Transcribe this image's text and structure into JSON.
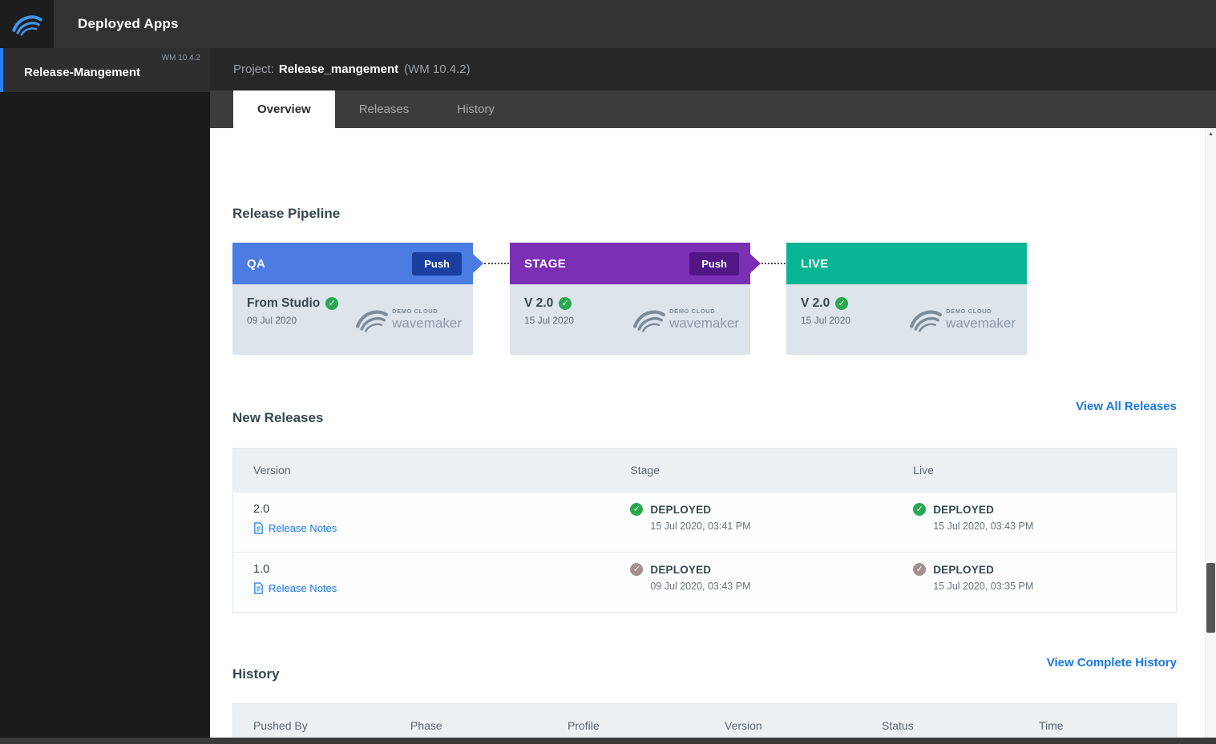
{
  "topbar": {
    "title": "Deployed Apps"
  },
  "sidebar": {
    "selected": {
      "name": "Release-Mangement",
      "version": "WM 10.4.2"
    }
  },
  "project_header": {
    "label": "Project:",
    "name": "Release_mangement",
    "version": "(WM 10.4.2)"
  },
  "tabs": [
    {
      "label": "Overview",
      "active": true
    },
    {
      "label": "Releases",
      "active": false
    },
    {
      "label": "History",
      "active": false
    }
  ],
  "pipeline": {
    "heading": "Release Pipeline",
    "stages": [
      {
        "name": "QA",
        "push_label": "Push",
        "version": "From Studio",
        "date": "09 Jul 2020",
        "header_color": "#4a7ce2",
        "push_color": "#1b3f9f"
      },
      {
        "name": "STAGE",
        "push_label": "Push",
        "version": "V 2.0",
        "date": "15 Jul 2020",
        "header_color": "#7b2fb4",
        "push_color": "#521786"
      },
      {
        "name": "LIVE",
        "version": "V 2.0",
        "date": "15 Jul 2020",
        "header_color": "#07b493"
      }
    ],
    "logo": {
      "line1": "DEMO CLOUD",
      "line2": "wavemaker"
    }
  },
  "new_releases": {
    "heading": "New Releases",
    "view_all_label": "View All Releases",
    "columns": [
      "Version",
      "Stage",
      "Live"
    ],
    "rows": [
      {
        "version": "2.0",
        "notes_label": "Release Notes",
        "stage": {
          "status": "DEPLOYED",
          "time": "15 Jul 2020, 03:41 PM",
          "check_color": "green"
        },
        "live": {
          "status": "DEPLOYED",
          "time": "15 Jul 2020, 03:43 PM",
          "check_color": "green"
        }
      },
      {
        "version": "1.0",
        "notes_label": "Release Notes",
        "stage": {
          "status": "DEPLOYED",
          "time": "09 Jul 2020, 03:43 PM",
          "check_color": "muted"
        },
        "live": {
          "status": "DEPLOYED",
          "time": "15 Jul 2020, 03:35 PM",
          "check_color": "muted"
        }
      }
    ]
  },
  "history": {
    "heading": "History",
    "view_all_label": "View Complete History",
    "columns": [
      "Pushed By",
      "Phase",
      "Profile",
      "Version",
      "Status",
      "Time"
    ]
  },
  "colors": {
    "accent_link_blue": "#1878e0",
    "qa_header": "#4a7ce2",
    "qa_push": "#1b3f9f",
    "stage_header": "#7b2fb4",
    "stage_push": "#521786",
    "live_header": "#07b493",
    "check_green": "#28a94f",
    "check_muted": "#a38f8f",
    "card_body": "#dde4ec",
    "sidebar_selected_border": "#2a7fff"
  }
}
